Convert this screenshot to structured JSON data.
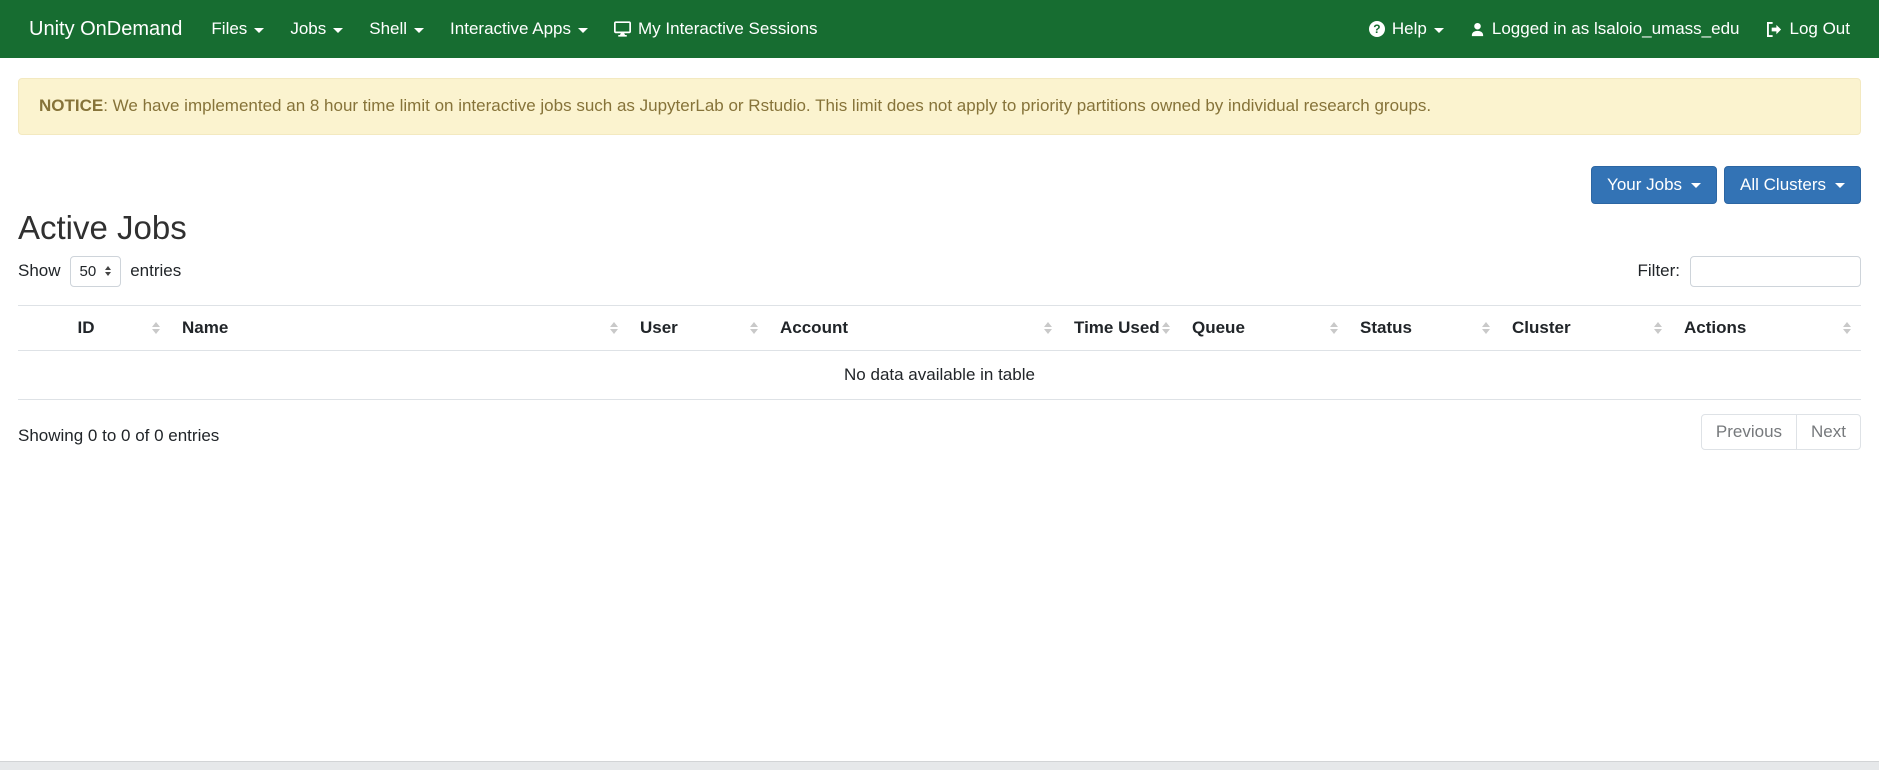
{
  "navbar": {
    "brand": "Unity OnDemand",
    "items": [
      {
        "label": "Files"
      },
      {
        "label": "Jobs"
      },
      {
        "label": "Shell"
      },
      {
        "label": "Interactive Apps"
      },
      {
        "label": "My Interactive Sessions"
      }
    ],
    "help_label": "Help",
    "logged_in_label": "Logged in as lsaloio_umass_edu",
    "logout_label": "Log Out"
  },
  "notice": {
    "label": "NOTICE",
    "text": ": We have implemented an 8 hour time limit on interactive jobs such as JupyterLab or Rstudio. This limit does not apply to priority partitions owned by individual research groups."
  },
  "toolbar": {
    "your_jobs_label": "Your Jobs",
    "all_clusters_label": "All Clusters"
  },
  "page": {
    "title": "Active Jobs"
  },
  "controls": {
    "show_label": "Show",
    "page_length": "50",
    "entries_label": "entries",
    "filter_label": "Filter:"
  },
  "table": {
    "columns": [
      "ID",
      "Name",
      "User",
      "Account",
      "Time Used",
      "Queue",
      "Status",
      "Cluster",
      "Actions"
    ],
    "empty_text": "No data available in table",
    "info": "Showing 0 to 0 of 0 entries"
  },
  "pagination": {
    "previous_label": "Previous",
    "next_label": "Next"
  },
  "colors": {
    "navbar_green": "#176d31",
    "button_blue": "#3373b5",
    "notice_bg": "#fbf3cf",
    "notice_text": "#867339",
    "table_border": "#dee2e6"
  }
}
